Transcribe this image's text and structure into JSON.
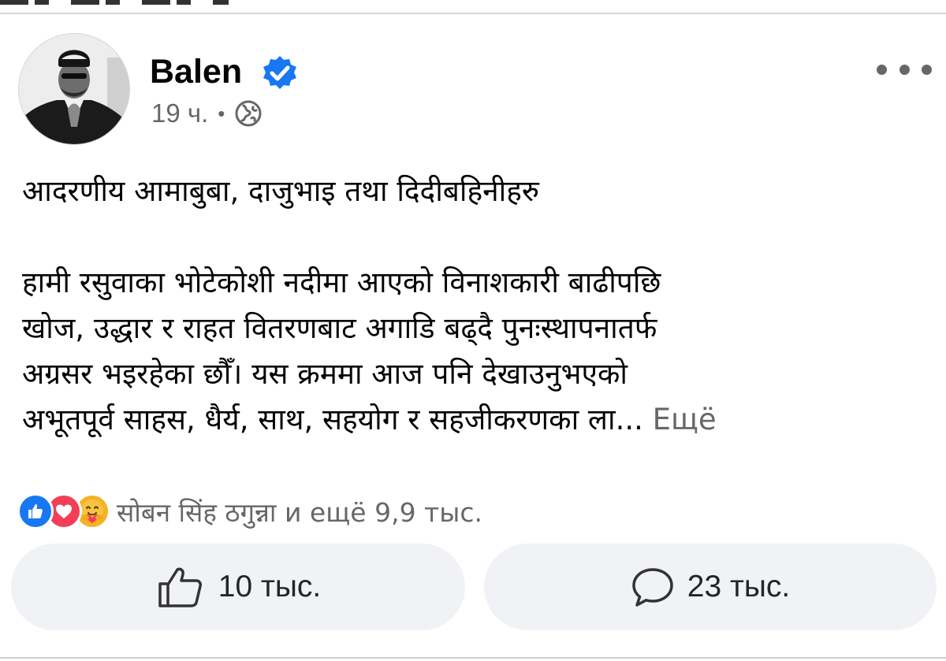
{
  "post": {
    "author": {
      "name": "Balen",
      "verified": true
    },
    "time": "19 ч.",
    "separator": "•",
    "privacy_icon": "globe-icon",
    "more_icon": "more-horizontal-icon",
    "text": {
      "greeting": "आदरणीय आमाबुबा, दाजुभाइ तथा दिदीबहिनीहरु",
      "lines": [
        "हामी रसुवाका भोटेकोशी नदीमा आएको विनाशकारी बाढीपछि",
        "खोज, उद्धार र राहत वितरणबाट अगाडि बढ्दै पुनःस्थापनातर्फ",
        "अग्रसर भइरहेका छौँ। यस क्रममा आज पनि देखाउनुभएको"
      ],
      "last_line": "अभूतपूर्व साहस, धैर्य, साथ, सहयोग र सहजीकरणका ला...",
      "see_more": "Ещё"
    },
    "reactions": {
      "types": [
        "like",
        "love",
        "care"
      ],
      "summary": "सोबन सिंह ठगुन्ना и ещё 9,9 тыс."
    },
    "actions": {
      "like_count": "10 тыс.",
      "comment_count": "23 тыс."
    }
  },
  "colors": {
    "accent": "#1877f2",
    "love": "#f33e58",
    "care": "#f7b125",
    "secondary_text": "#65676b",
    "button_bg": "#f0f2f5"
  }
}
